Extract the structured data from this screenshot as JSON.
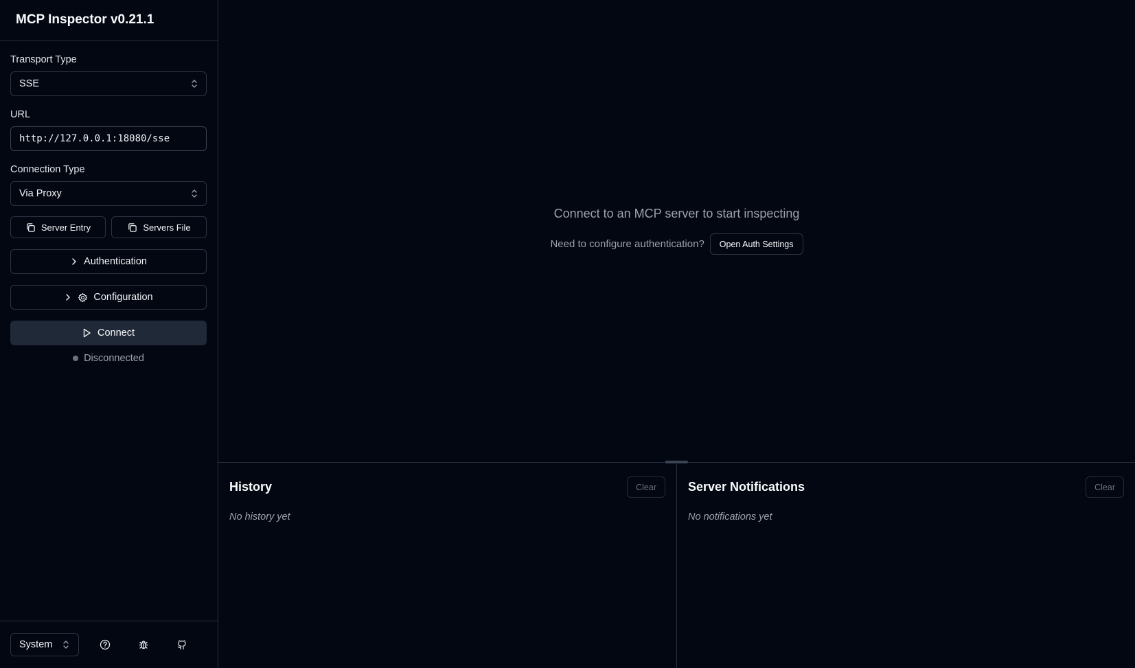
{
  "app": {
    "title": "MCP Inspector v0.21.1"
  },
  "sidebar": {
    "transport_label": "Transport Type",
    "transport_value": "SSE",
    "url_label": "URL",
    "url_value": "http://127.0.0.1:18080/sse",
    "connection_label": "Connection Type",
    "connection_value": "Via Proxy",
    "server_entry_label": "Server Entry",
    "servers_file_label": "Servers File",
    "authentication_label": "Authentication",
    "configuration_label": "Configuration",
    "connect_label": "Connect",
    "status_text": "Disconnected",
    "theme_value": "System"
  },
  "main": {
    "empty_title": "Connect to an MCP server to start inspecting",
    "auth_prompt": "Need to configure authentication?",
    "auth_button": "Open Auth Settings"
  },
  "history": {
    "title": "History",
    "clear_label": "Clear",
    "empty_text": "No history yet"
  },
  "notifications": {
    "title": "Server Notifications",
    "clear_label": "Clear",
    "empty_text": "No notifications yet"
  },
  "icons": {
    "copy": "copy-icon",
    "chevron_right": "chevron-right-icon",
    "gear": "gear-icon",
    "play": "play-icon",
    "help": "help-circle-icon",
    "bug": "bug-icon",
    "github": "github-icon",
    "updown": "chevrons-up-down-icon"
  },
  "colors": {
    "background": "#030712",
    "border": "#273040",
    "connect_button": "#1f2937",
    "muted_text": "#9ca3af"
  }
}
